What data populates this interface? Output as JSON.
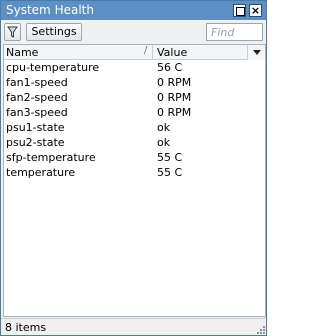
{
  "window": {
    "title": "System Health"
  },
  "toolbar": {
    "filter_icon": "filter-icon",
    "settings_label": "Settings",
    "find_placeholder": "Find"
  },
  "table": {
    "columns": [
      "Name",
      "Value"
    ],
    "rows": [
      {
        "name": "cpu-temperature",
        "value": "56 C"
      },
      {
        "name": "fan1-speed",
        "value": "0 RPM"
      },
      {
        "name": "fan2-speed",
        "value": "0 RPM"
      },
      {
        "name": "fan3-speed",
        "value": "0 RPM"
      },
      {
        "name": "psu1-state",
        "value": "ok"
      },
      {
        "name": "psu2-state",
        "value": "ok"
      },
      {
        "name": "sfp-temperature",
        "value": "55 C"
      },
      {
        "name": "temperature",
        "value": "55 C"
      }
    ]
  },
  "status": {
    "text": "8 items"
  },
  "colors": {
    "titlebar": "#5c8fc3",
    "window_bg": "#f0f0f0",
    "list_bg": "#ffffff"
  }
}
